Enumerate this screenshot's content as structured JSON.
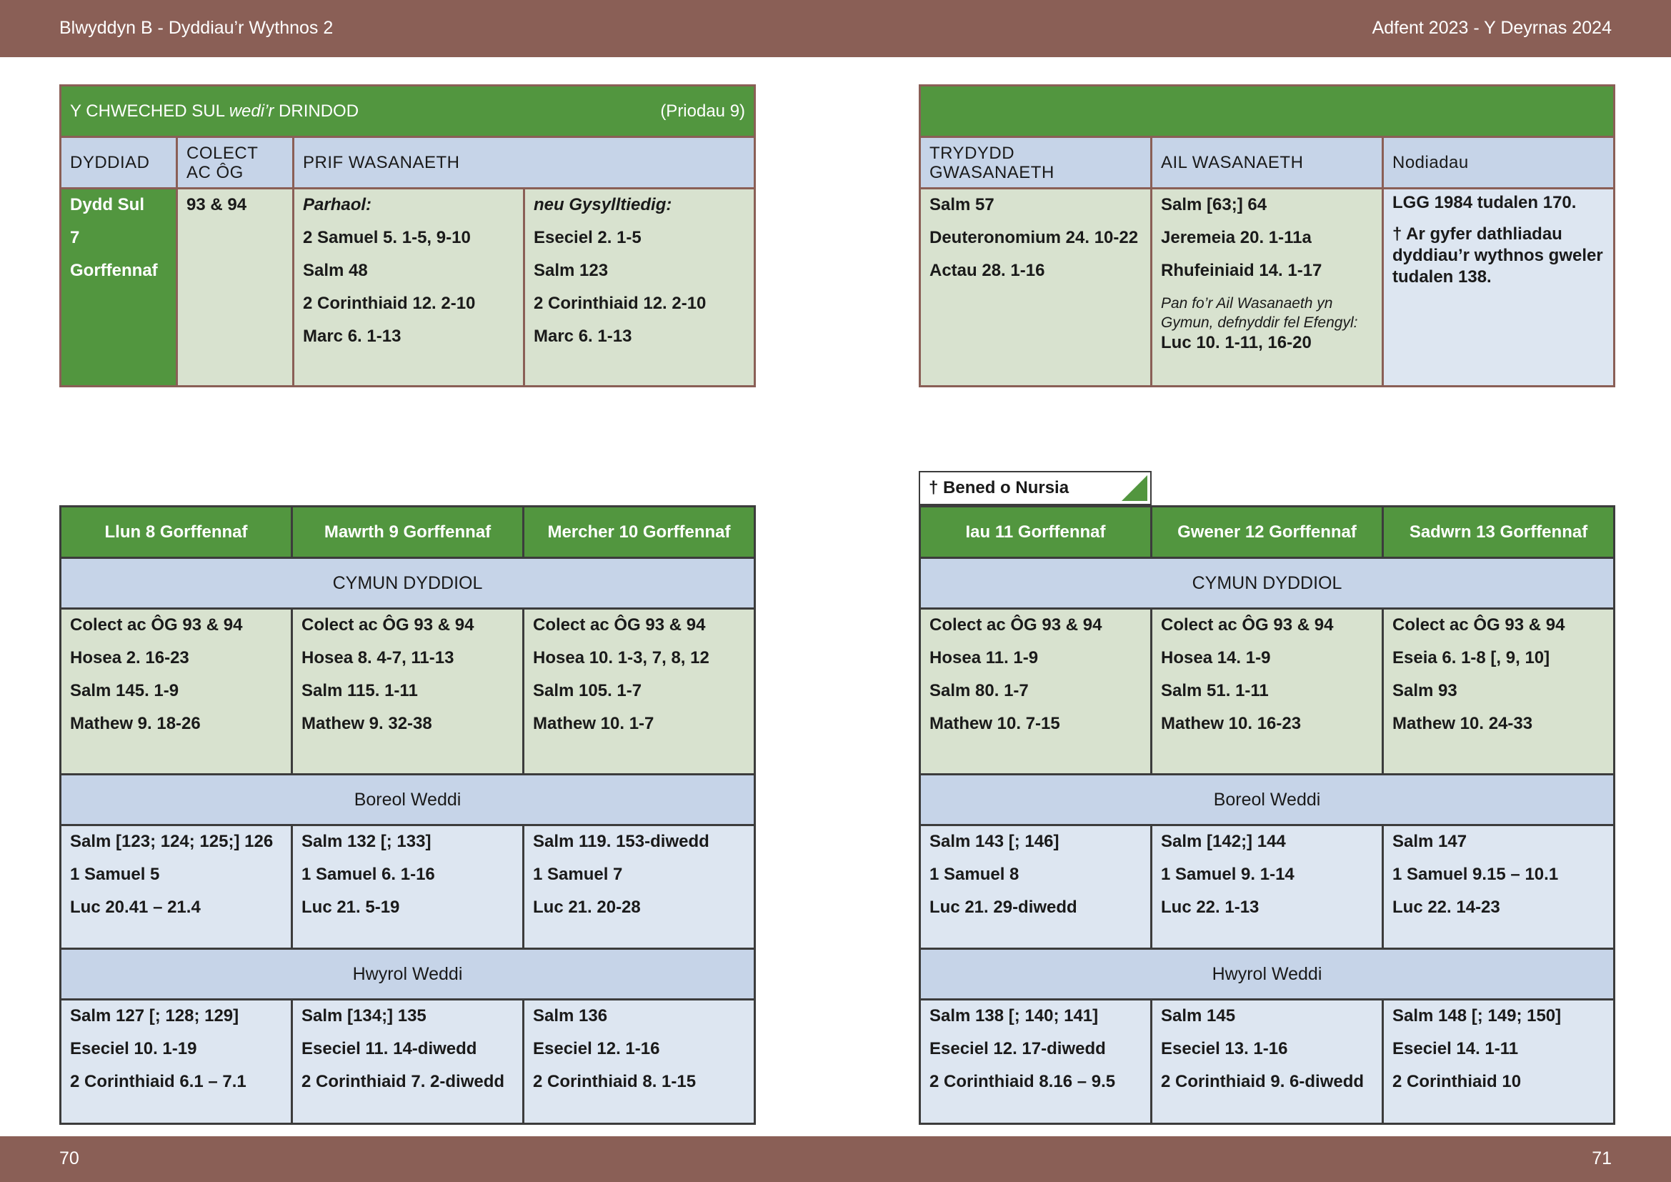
{
  "header": {
    "left": "Blwyddyn  B - Dyddiau’r Wythnos 2",
    "right": "Adfent  2023 - Y Deyrnas 2024"
  },
  "footer": {
    "left_page": "70",
    "right_page": "71"
  },
  "sunday": {
    "title_a": "Y CHWECHED SUL ",
    "title_b": "wedi’r",
    "title_c": " DRINDOD",
    "ref": "(Priodau 9)",
    "headers": {
      "date": "DYDDIAD",
      "collect": "COLECT AC ÔG",
      "main": "PRIF WASANAETH"
    },
    "date_lines": [
      "Dydd Sul",
      "7",
      "Gorffennaf"
    ],
    "collect": "93 & 94",
    "continuous": [
      "Parhaol:",
      "2 Samuel 5. 1-5, 9-10",
      "Salm 48",
      "2 Corinthiaid 12. 2-10",
      "Marc 6. 1-13"
    ],
    "related": [
      "neu Gysylltiedig:",
      "Eseciel 2. 1-5",
      "Salm 123",
      "2 Corinthiaid 12. 2-10",
      "Marc 6. 1-13"
    ]
  },
  "services": {
    "headers": {
      "third": "TRYDYDD GWASANAETH",
      "second": "AIL WASANAETH",
      "notes": "Nodiadau"
    },
    "third": [
      "Salm 57",
      "Deuteronomium 24. 10-22",
      "Actau 28. 1-16"
    ],
    "second": [
      "Salm [63;] 64",
      "Jeremeia 20. 1-11a",
      "Rhufeiniaid 14. 1-17"
    ],
    "second_note": "Pan fo’r Ail Wasanaeth yn Gymun, defnyddir fel Efengyl:",
    "second_gospel": "Luc 10. 1-11, 16-20",
    "notes": [
      "LGG 1984 tudalen 170.",
      "† Ar gyfer dathliadau dyddiau’r wythnos gweler tudalen 138."
    ]
  },
  "commemoration": "† Bened o Nursia",
  "sections": {
    "eucharist": "CYMUN DYDDIOL",
    "morning": "Boreol Weddi",
    "evening": "Hwyrol Weddi"
  },
  "left_days": [
    {
      "name": "Llun 8 Gorffennaf",
      "eucharist": [
        "Colect ac ÔG 93 & 94",
        "Hosea 2. 16-23",
        "Salm 145. 1-9",
        "Mathew 9. 18-26"
      ],
      "morning": [
        "Salm [123; 124; 125;] 126",
        "1 Samuel 5",
        "Luc 20.41 – 21.4"
      ],
      "evening": [
        "Salm 127 [; 128; 129]",
        "Eseciel 10. 1-19",
        "2 Corinthiaid 6.1 – 7.1"
      ]
    },
    {
      "name": "Mawrth 9 Gorffennaf",
      "eucharist": [
        "Colect ac ÔG 93 & 94",
        "Hosea 8. 4-7, 11-13",
        "Salm 115. 1-11",
        "Mathew 9. 32-38"
      ],
      "morning": [
        "Salm 132 [; 133]",
        "1 Samuel 6. 1-16",
        "Luc 21. 5-19"
      ],
      "evening": [
        "Salm [134;] 135",
        "Eseciel 11. 14-diwedd",
        "2 Corinthiaid 7. 2-diwedd"
      ]
    },
    {
      "name": "Mercher 10 Gorffennaf",
      "eucharist": [
        "Colect ac ÔG 93 & 94",
        "Hosea 10. 1-3, 7, 8, 12",
        "Salm 105. 1-7",
        "Mathew 10. 1-7"
      ],
      "morning": [
        "Salm 119. 153-diwedd",
        "1 Samuel 7",
        "Luc 21. 20-28"
      ],
      "evening": [
        "Salm 136",
        "Eseciel 12. 1-16",
        "2 Corinthiaid 8. 1-15"
      ]
    }
  ],
  "right_days": [
    {
      "name": "Iau 11 Gorffennaf",
      "eucharist": [
        "Colect ac ÔG 93 & 94",
        "Hosea 11. 1-9",
        "Salm 80. 1-7",
        "Mathew 10. 7-15"
      ],
      "morning": [
        "Salm 143 [; 146]",
        "1 Samuel 8",
        "Luc 21. 29-diwedd"
      ],
      "evening": [
        "Salm 138 [; 140; 141]",
        "Eseciel 12. 17-diwedd",
        "2 Corinthiaid 8.16 – 9.5"
      ]
    },
    {
      "name": "Gwener 12 Gorffennaf",
      "eucharist": [
        "Colect ac ÔG 93 & 94",
        "Hosea 14. 1-9",
        "Salm 51. 1-11",
        "Mathew 10. 16-23"
      ],
      "morning": [
        "Salm [142;] 144",
        "1 Samuel 9. 1-14",
        "Luc 22. 1-13"
      ],
      "evening": [
        "Salm 145",
        "Eseciel 13. 1-16",
        "2 Corinthiaid 9. 6-diwedd"
      ]
    },
    {
      "name": "Sadwrn 13 Gorffennaf",
      "eucharist": [
        "Colect ac ÔG 93 & 94",
        "Eseia 6. 1-8 [, 9, 10]",
        "Salm 93",
        "Mathew 10. 24-33"
      ],
      "morning": [
        "Salm 147",
        "1 Samuel 9.15 – 10.1",
        "Luc 22. 14-23"
      ],
      "evening": [
        "Salm 148 [; 149; 150]",
        " Eseciel 14. 1-11",
        "2 Corinthiaid 10"
      ]
    }
  ]
}
